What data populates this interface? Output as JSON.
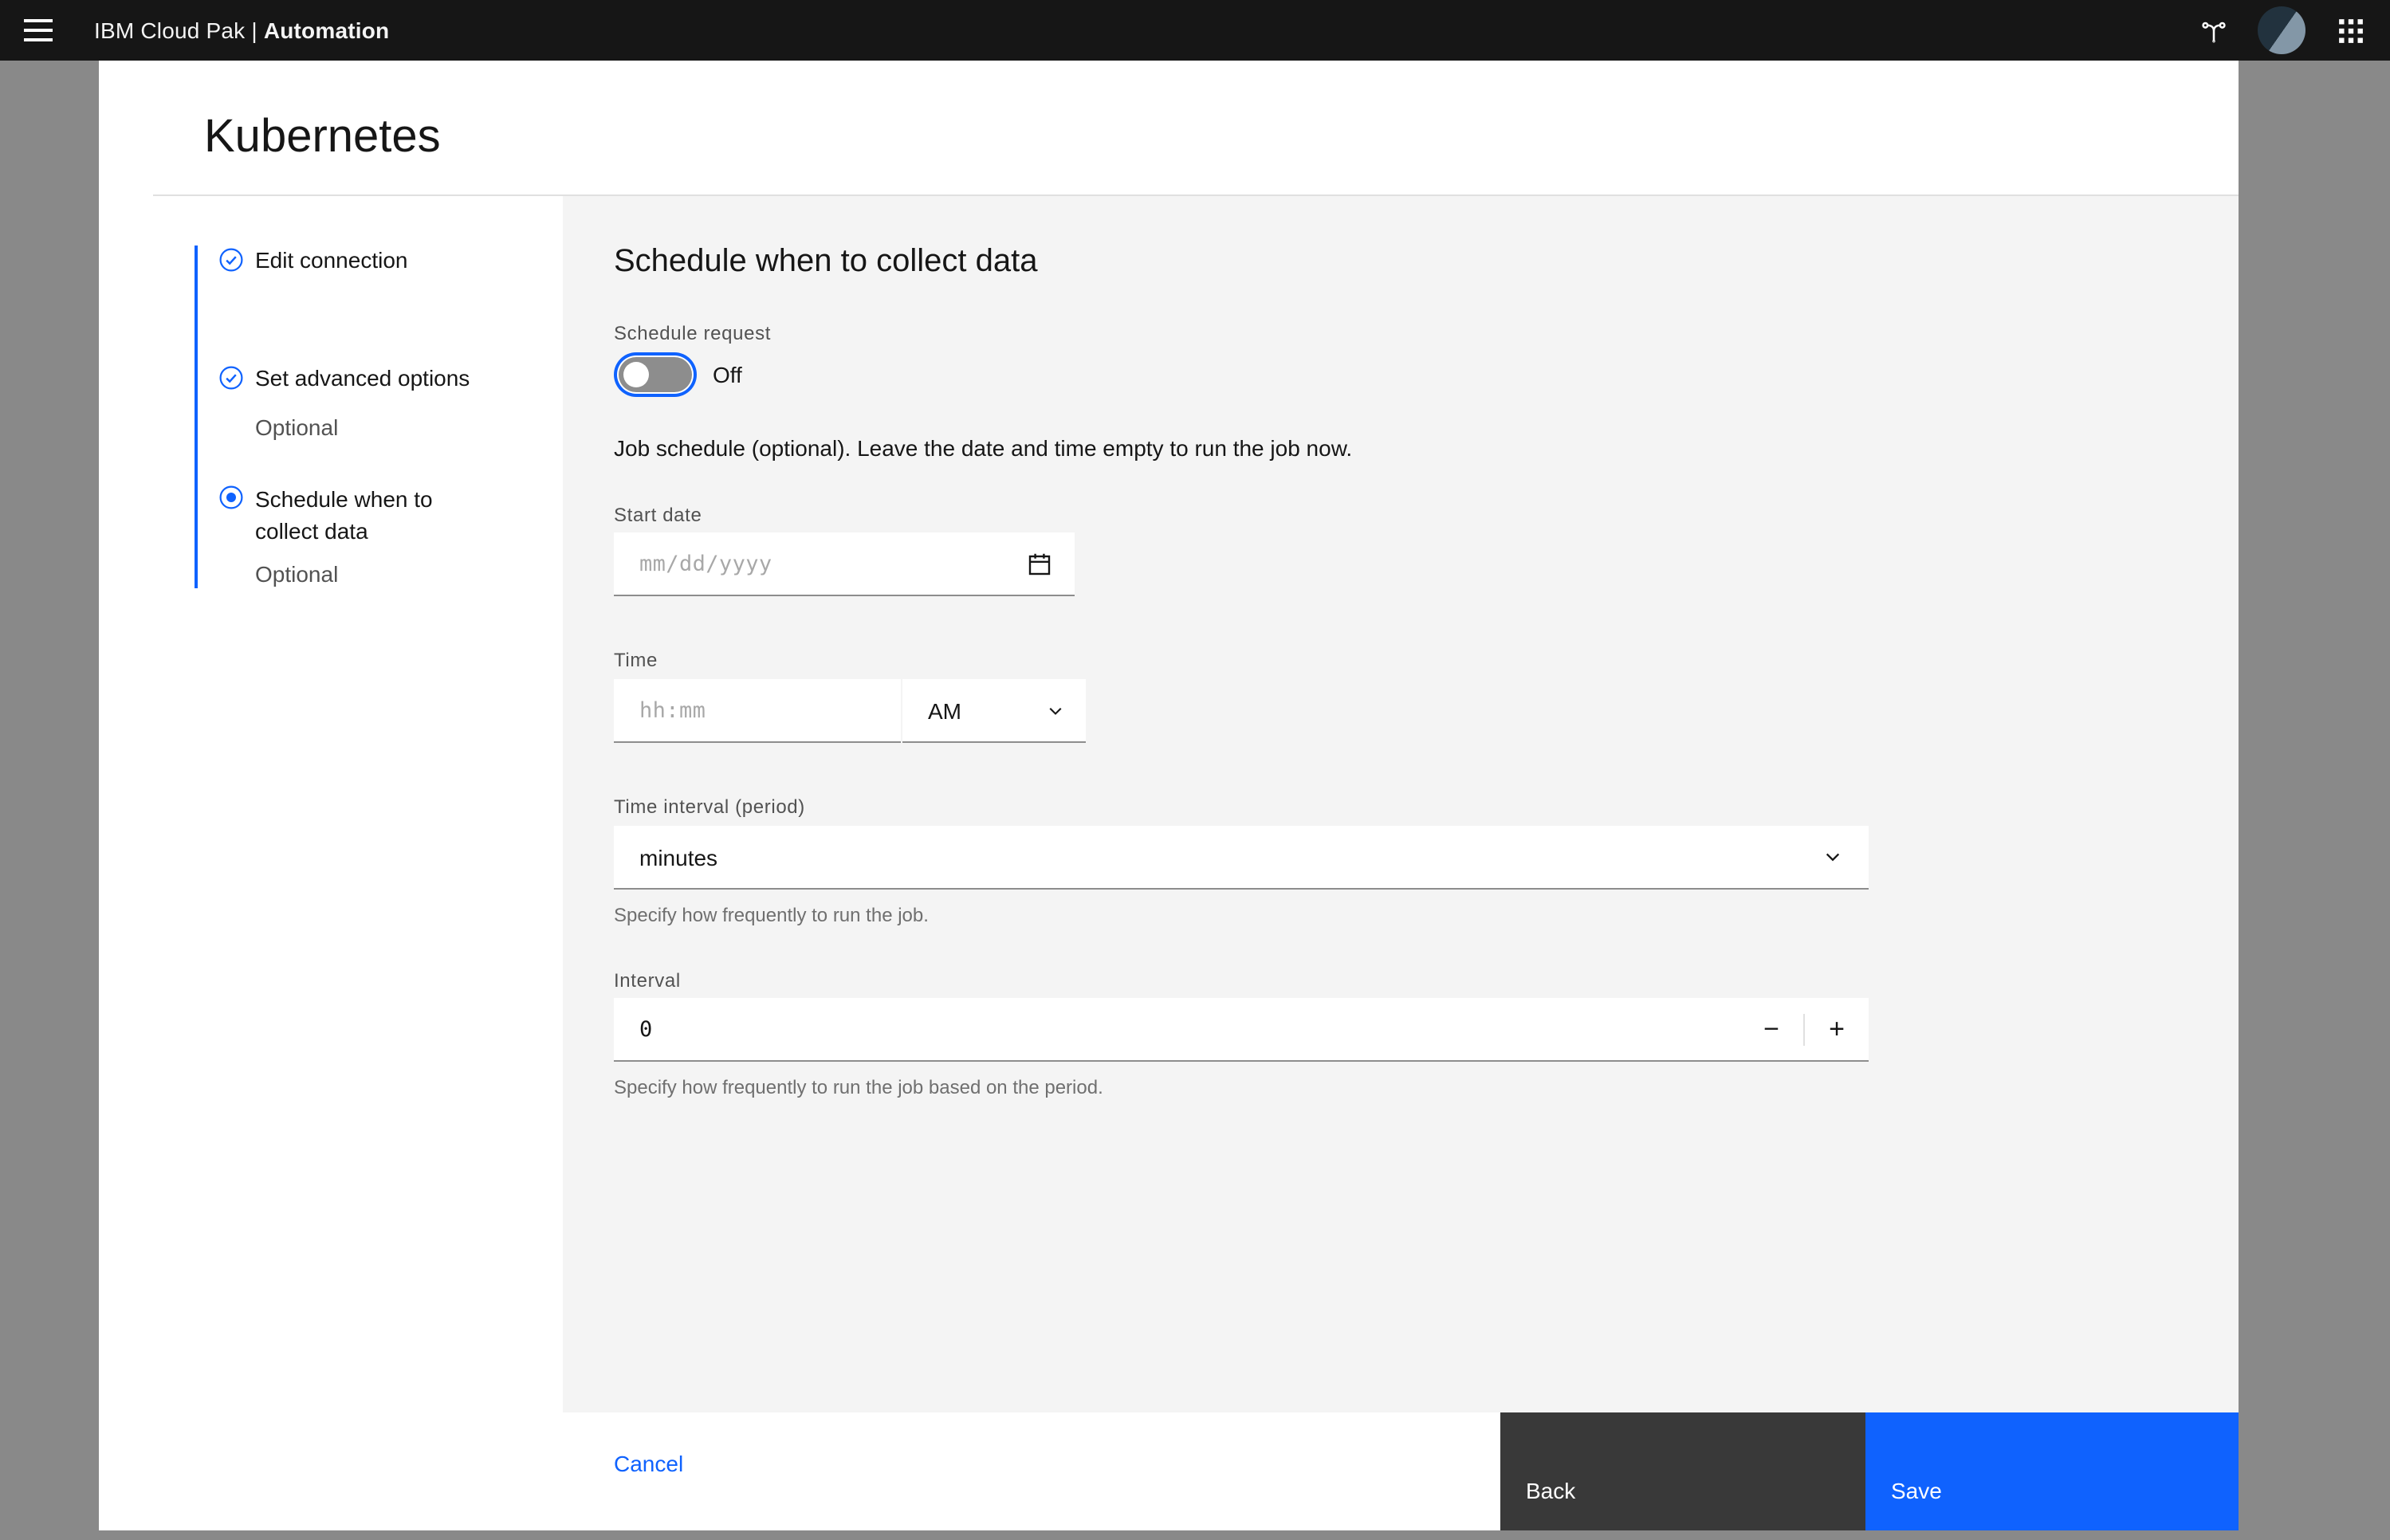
{
  "colors": {
    "accent": "#0f62fe",
    "header_bg": "#161616",
    "content_bg": "#f4f4f4",
    "back_button_bg": "#393939",
    "backdrop": "#898989",
    "label_text": "#525252",
    "helper_text": "#6f6f6f"
  },
  "icons": {
    "menu-icon": "hamburger",
    "fork-icon": "fork",
    "app-switcher-icon": "grid",
    "calendar-icon": "calendar",
    "chevron-down-icon": "chevron-down",
    "minus": "−",
    "plus": "+"
  },
  "header": {
    "brand": "IBM Cloud Pak |",
    "brand_bold": "Automation"
  },
  "modal": {
    "title": "Kubernetes"
  },
  "steps": [
    {
      "label": "Edit connection",
      "sublabel": "",
      "state": "complete"
    },
    {
      "label": "Set advanced options",
      "sublabel": "Optional",
      "state": "complete"
    },
    {
      "label": "Schedule when to collect data",
      "sublabel": "Optional",
      "state": "current"
    }
  ],
  "form": {
    "heading": "Schedule when to collect data",
    "schedule_request_label": "Schedule request",
    "toggle_state": "Off",
    "description": "Job schedule (optional). Leave the date and time empty to run the job now.",
    "start_date": {
      "label": "Start date",
      "placeholder": "mm/dd/yyyy"
    },
    "time": {
      "label": "Time",
      "placeholder": "hh:mm",
      "meridiem": "AM"
    },
    "period": {
      "label": "Time interval (period)",
      "value": "minutes",
      "helper": "Specify how frequently to run the job."
    },
    "interval": {
      "label": "Interval",
      "value": "0",
      "helper": "Specify how frequently to run the job based on the period."
    }
  },
  "footer": {
    "cancel": "Cancel",
    "back": "Back",
    "save": "Save"
  }
}
